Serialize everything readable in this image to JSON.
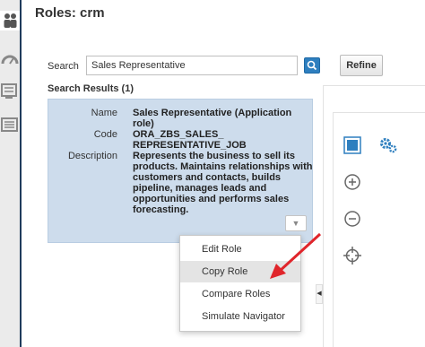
{
  "page": {
    "title": "Roles: crm"
  },
  "search": {
    "label": "Search",
    "value": "Sales Representative",
    "refine_label": "Refine"
  },
  "results": {
    "heading": "Search Results (1)",
    "name_label": "Name",
    "name_line1": "Sales Representative (Application",
    "name_line2": "role)",
    "code_label": "Code",
    "code_line1": "ORA_ZBS_SALES_",
    "code_line2": "REPRESENTATIVE_JOB",
    "description_label": "Description",
    "description_lines": [
      "Represents the business to sell its",
      "products. Maintains relationships with",
      "customers and contacts, builds",
      "pipeline, manages leads and",
      "opportunities and performs sales",
      "forecasting."
    ]
  },
  "menu": {
    "items": [
      "Edit Role",
      "Copy Role",
      "Compare Roles",
      "Simulate Navigator"
    ],
    "highlighted_index": 1
  },
  "colors": {
    "accent": "#2e7fbf",
    "card_bg": "#cddcec",
    "nav_bar": "#1f3b5c",
    "arrow": "#e0252b"
  },
  "icons": [
    "people-icon",
    "dashboard-icon",
    "report-icon",
    "list-icon",
    "search-icon",
    "chevron-down-icon",
    "select-icon",
    "gear-icon",
    "zoom-in-icon",
    "zoom-out-icon",
    "crosshair-icon",
    "collapse-icon"
  ]
}
